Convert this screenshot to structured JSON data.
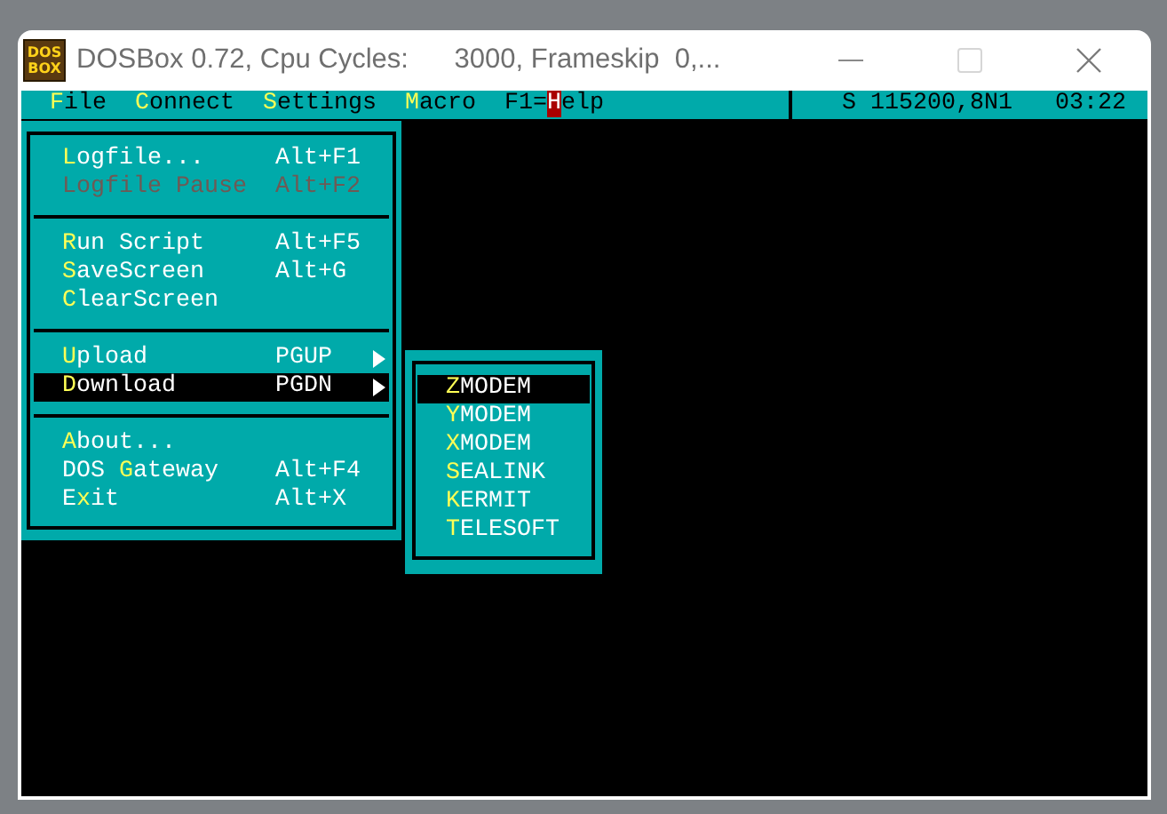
{
  "window": {
    "title": "DOSBox 0.72, Cpu Cycles:      3000, Frameskip  0,...",
    "logo": [
      "DOS",
      "BOX"
    ],
    "maximize_disabled": true
  },
  "menubar": [
    {
      "label": "**F**ile",
      "kind": "menu"
    },
    {
      "label": "**C**onnect",
      "kind": "menu"
    },
    {
      "label": "**S**ettings",
      "kind": "menu"
    },
    {
      "label": "**M**acro",
      "kind": "menu"
    },
    {
      "label": "F1=**H**elp",
      "kind": "help"
    }
  ],
  "status": {
    "line": "S 115200,8N1",
    "time": "03:22"
  },
  "file_menu": {
    "groups": [
      [
        {
          "label": "**L**ogfile...",
          "shortcut": "Alt+F1",
          "disabled": false,
          "selected": false,
          "submenu": false
        },
        {
          "label": "Logfile Pause",
          "shortcut": "Alt+F2",
          "disabled": true,
          "selected": false,
          "submenu": false
        }
      ],
      [
        {
          "label": "**R**un Script",
          "shortcut": "Alt+F5",
          "disabled": false,
          "selected": false,
          "submenu": false
        },
        {
          "label": "**S**aveScreen",
          "shortcut": "Alt+G",
          "disabled": false,
          "selected": false,
          "submenu": false
        },
        {
          "label": "**C**learScreen",
          "disabled": false,
          "selected": false,
          "submenu": false
        }
      ],
      [
        {
          "label": "**U**pload",
          "shortcut": "PGUP",
          "disabled": false,
          "selected": false,
          "submenu": true
        },
        {
          "label": "**D**ownload",
          "shortcut": "PGDN",
          "disabled": false,
          "selected": true,
          "submenu": true
        }
      ],
      [
        {
          "label": "**A**bout...",
          "disabled": false,
          "selected": false,
          "submenu": false
        },
        {
          "label": "DOS **G**ateway",
          "shortcut": "Alt+F4",
          "disabled": false,
          "selected": false,
          "submenu": false
        },
        {
          "label": "E**x**it",
          "shortcut": "Alt+X",
          "disabled": false,
          "selected": false,
          "submenu": false
        }
      ]
    ]
  },
  "download_menu": {
    "items": [
      {
        "label": "**Z**MODEM",
        "selected": true
      },
      {
        "label": "**Y**MODEM",
        "selected": false
      },
      {
        "label": "**X**MODEM",
        "selected": false
      },
      {
        "label": "**S**EALINK",
        "selected": false
      },
      {
        "label": "**K**ERMIT",
        "selected": false
      },
      {
        "label": "**T**ELESOFT",
        "selected": false
      }
    ]
  }
}
